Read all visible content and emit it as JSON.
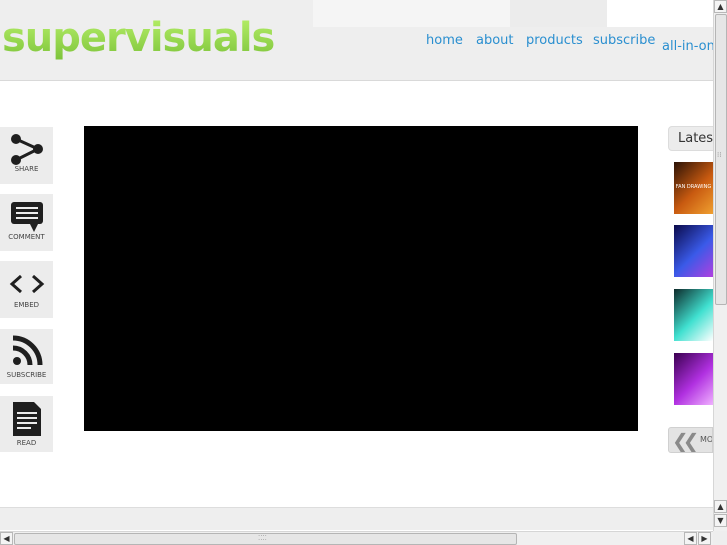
{
  "header": {
    "logo_text": "supervisuals",
    "nav": [
      {
        "label": "home"
      },
      {
        "label": "about"
      },
      {
        "label": "products"
      },
      {
        "label": "subscribe"
      },
      {
        "label": "all-in-one"
      }
    ]
  },
  "share_bar": {
    "items": [
      {
        "label": "SHARE",
        "icon": "share-icon"
      },
      {
        "label": "COMMENT",
        "icon": "comment-icon"
      },
      {
        "label": "EMBED",
        "icon": "embed-icon"
      },
      {
        "label": "SUBSCRIBE",
        "icon": "rss-icon"
      },
      {
        "label": "READ",
        "icon": "document-icon"
      }
    ]
  },
  "latest": {
    "title": "Latest",
    "thumbnails": [
      {
        "caption": "FAN DRAWING",
        "colors": [
          "#2a1206",
          "#c85a10",
          "#f0a030"
        ]
      },
      {
        "caption": "",
        "colors": [
          "#0a0a4a",
          "#3a5ae8",
          "#b040e0"
        ]
      },
      {
        "caption": "",
        "colors": [
          "#0d2a2a",
          "#40e0d0",
          "#ffffff"
        ]
      },
      {
        "caption": "",
        "colors": [
          "#3a0050",
          "#b030e0",
          "#f0b0ff"
        ]
      }
    ],
    "more_label": "MO"
  },
  "colors": {
    "logo_green": "#8fd64a",
    "nav_blue": "#2a8fd0",
    "video_bg": "#000000"
  }
}
